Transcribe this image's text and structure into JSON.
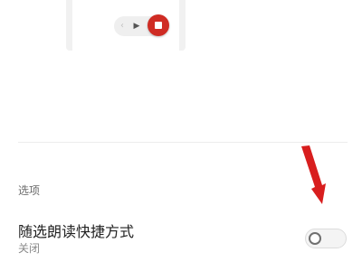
{
  "preview": {
    "controls": {
      "prev_icon": "chevron-left-icon",
      "play_icon": "play-icon",
      "stop_icon": "stop-icon",
      "stop_color": "#cf2c24"
    }
  },
  "options_section": {
    "header": "选项",
    "items": [
      {
        "title": "随选朗读快捷方式",
        "status": "关闭",
        "toggle_on": false
      }
    ]
  },
  "annotation": {
    "icon": "red-arrow-icon",
    "color": "#d81e1e"
  }
}
